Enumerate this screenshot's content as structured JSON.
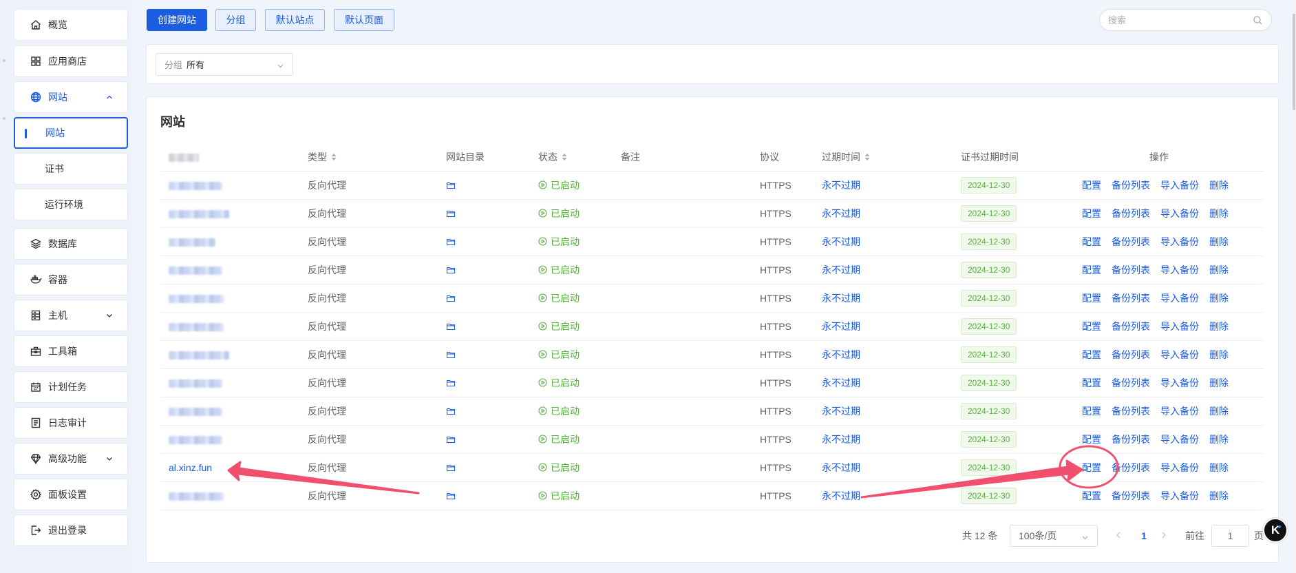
{
  "sidebar": {
    "items": [
      {
        "label": "概览",
        "icon": "home-icon"
      },
      {
        "label": "应用商店",
        "icon": "grid-icon"
      },
      {
        "label": "网站",
        "icon": "globe-icon"
      },
      {
        "label": "网站"
      },
      {
        "label": "证书"
      },
      {
        "label": "运行环境"
      },
      {
        "label": "数据库",
        "icon": "layers-icon"
      },
      {
        "label": "容器",
        "icon": "docker-icon"
      },
      {
        "label": "主机",
        "icon": "server-icon"
      },
      {
        "label": "工具箱",
        "icon": "toolbox-icon"
      },
      {
        "label": "计划任务",
        "icon": "calendar-icon"
      },
      {
        "label": "日志审计",
        "icon": "log-icon"
      },
      {
        "label": "高级功能",
        "icon": "diamond-icon"
      },
      {
        "label": "面板设置",
        "icon": "gear-icon"
      },
      {
        "label": "退出登录",
        "icon": "logout-icon"
      }
    ]
  },
  "toolbar": {
    "create_label": "创建网站",
    "group_label": "分组",
    "default_site_label": "默认站点",
    "default_page_label": "默认页面",
    "search_placeholder": "搜索"
  },
  "filter": {
    "label": "分组",
    "value": "所有"
  },
  "table": {
    "title": "网站",
    "headers": {
      "type": "类型",
      "dir": "网站目录",
      "status": "状态",
      "remark": "备注",
      "protocol": "协议",
      "expire": "过期时间",
      "cert_expire": "证书过期时间",
      "actions": "操作"
    },
    "rows": [
      {
        "domain": "",
        "type": "反向代理",
        "status": "已启动",
        "protocol": "HTTPS",
        "expire": "永不过期",
        "cert": "2024-12-30"
      },
      {
        "domain": "",
        "type": "反向代理",
        "status": "已启动",
        "protocol": "HTTPS",
        "expire": "永不过期",
        "cert": "2024-12-30"
      },
      {
        "domain": "",
        "type": "反向代理",
        "status": "已启动",
        "protocol": "HTTPS",
        "expire": "永不过期",
        "cert": "2024-12-30"
      },
      {
        "domain": "",
        "type": "反向代理",
        "status": "已启动",
        "protocol": "HTTPS",
        "expire": "永不过期",
        "cert": "2024-12-30"
      },
      {
        "domain": "",
        "type": "反向代理",
        "status": "已启动",
        "protocol": "HTTPS",
        "expire": "永不过期",
        "cert": "2024-12-30"
      },
      {
        "domain": "",
        "type": "反向代理",
        "status": "已启动",
        "protocol": "HTTPS",
        "expire": "永不过期",
        "cert": "2024-12-30"
      },
      {
        "domain": "",
        "type": "反向代理",
        "status": "已启动",
        "protocol": "HTTPS",
        "expire": "永不过期",
        "cert": "2024-12-30"
      },
      {
        "domain": "",
        "type": "反向代理",
        "status": "已启动",
        "protocol": "HTTPS",
        "expire": "永不过期",
        "cert": "2024-12-30"
      },
      {
        "domain": "",
        "type": "反向代理",
        "status": "已启动",
        "protocol": "HTTPS",
        "expire": "永不过期",
        "cert": "2024-12-30"
      },
      {
        "domain": "",
        "type": "反向代理",
        "status": "已启动",
        "protocol": "HTTPS",
        "expire": "永不过期",
        "cert": "2024-12-30"
      },
      {
        "domain": "al.xinz.fun",
        "type": "反向代理",
        "status": "已启动",
        "protocol": "HTTPS",
        "expire": "永不过期",
        "cert": "2024-12-30"
      },
      {
        "domain": "",
        "type": "反向代理",
        "status": "已启动",
        "protocol": "HTTPS",
        "expire": "永不过期",
        "cert": "2024-12-30"
      }
    ],
    "actions": [
      "配置",
      "备份列表",
      "导入备份",
      "删除"
    ]
  },
  "pagination": {
    "total_text": "共 12 条",
    "page_size": "100条/页",
    "current_page": "1",
    "goto_label": "前往",
    "goto_value": "1",
    "page_suffix": "页"
  },
  "float_widget": {
    "label": "K"
  },
  "colors": {
    "primary": "#1b5ce0",
    "success": "#52b43a",
    "annotation": "#f0506e"
  }
}
